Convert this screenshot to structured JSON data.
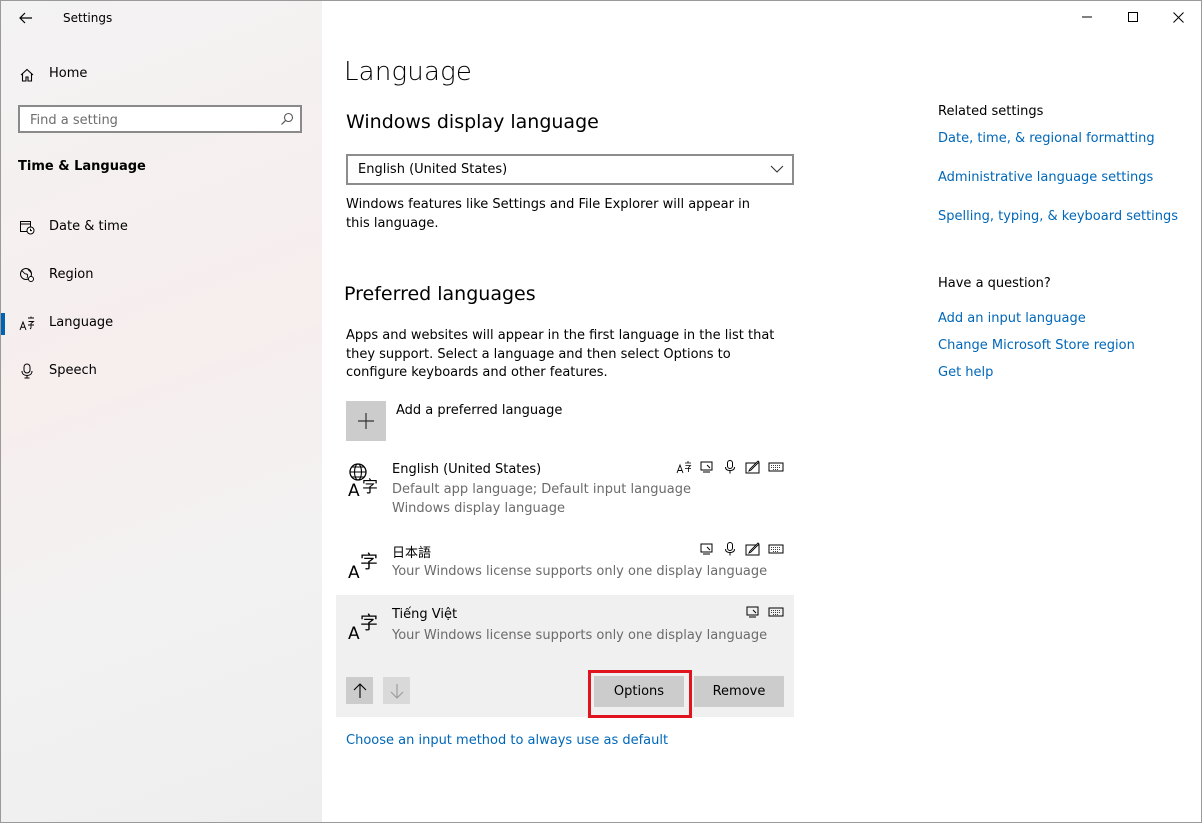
{
  "window": {
    "title": "Settings"
  },
  "nav": {
    "home_label": "Home",
    "search_placeholder": "Find a setting",
    "section": "Time & Language",
    "items": [
      {
        "label": "Date & time",
        "icon": "calendar-clock-icon"
      },
      {
        "label": "Region",
        "icon": "globe-region-icon"
      },
      {
        "label": "Language",
        "icon": "language-icon",
        "active": true
      },
      {
        "label": "Speech",
        "icon": "microphone-icon"
      }
    ]
  },
  "main": {
    "title": "Language",
    "display_heading": "Windows display language",
    "display_value": "English (United States)",
    "display_note": "Windows features like Settings and File Explorer will appear in this language.",
    "preferred_heading": "Preferred languages",
    "preferred_note": "Apps and websites will appear in the first language in the list that they support. Select a language and then select Options to configure keyboards and other features.",
    "add_label": "Add a preferred language",
    "languages": [
      {
        "name": "English (United States)",
        "desc_1": "Default app language; Default input language",
        "desc_2": "Windows display language",
        "features": [
          "display-language-icon",
          "text-to-speech-icon",
          "speech-icon",
          "handwriting-icon",
          "keyboard-icon"
        ]
      },
      {
        "name": "日本語",
        "desc_1": "Your Windows license supports only one display language",
        "features": [
          "text-to-speech-icon",
          "speech-icon",
          "handwriting-icon",
          "keyboard-icon"
        ]
      },
      {
        "name": "Tiếng Việt",
        "desc_1": "Your Windows license supports only one display language",
        "features": [
          "text-to-speech-icon",
          "keyboard-icon"
        ],
        "selected": true
      }
    ],
    "options_label": "Options",
    "remove_label": "Remove",
    "input_method_link": "Choose an input method to always use as default"
  },
  "related": {
    "heading": "Related settings",
    "links": [
      "Date, time, & regional formatting",
      "Administrative language settings",
      "Spelling, typing, & keyboard settings"
    ]
  },
  "question": {
    "heading": "Have a question?",
    "links": [
      "Add an input language",
      "Change Microsoft Store region",
      "Get help"
    ]
  },
  "colors": {
    "accent": "#0063b1",
    "link": "#0067b8",
    "highlight": "#e0141e",
    "button": "#cccccc"
  }
}
